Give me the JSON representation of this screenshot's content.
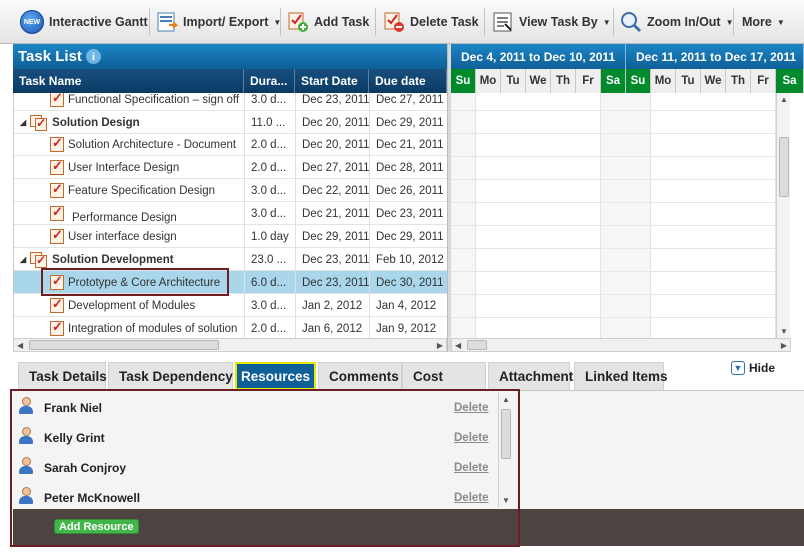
{
  "toolbar": {
    "items": [
      {
        "label": "Interactive Gantt",
        "icon": "new-badge-icon"
      },
      {
        "label": "Import/ Export",
        "icon": "import-export-icon",
        "dropdown": true
      },
      {
        "label": "Add Task",
        "icon": "add-task-icon"
      },
      {
        "label": "Delete Task",
        "icon": "delete-task-icon"
      },
      {
        "label": "View Task By",
        "icon": "view-task-icon",
        "dropdown": true
      },
      {
        "label": "Zoom In/Out",
        "icon": "zoom-icon",
        "dropdown": true
      },
      {
        "label": "More",
        "dropdown": true
      }
    ],
    "new_badge": "NEW"
  },
  "task_list": {
    "title": "Task List",
    "info_glyph": "i",
    "columns": [
      "Task Name",
      "Dura...",
      "Start Date",
      "Due date"
    ],
    "rows": [
      {
        "name": "Functional Specification – sign off",
        "duration": "3.0 d...",
        "start": "Dec 23, 2011",
        "due": "Dec 27, 2011",
        "level": 2
      },
      {
        "name": "Solution Design",
        "duration": "11.0 ...",
        "start": "Dec 20, 2011",
        "due": "Dec 29, 2011",
        "level": 0
      },
      {
        "name": "Solution Architecture - Document",
        "duration": "2.0 d...",
        "start": "Dec 20, 2011",
        "due": "Dec 21, 2011",
        "level": 1
      },
      {
        "name": "User Interface Design",
        "duration": "2.0 d...",
        "start": "Dec 27, 2011",
        "due": "Dec 28, 2011",
        "level": 1
      },
      {
        "name": "Feature Specification Design",
        "duration": "3.0 d...",
        "start": "Dec 22, 2011",
        "due": "Dec 26, 2011",
        "level": 1
      },
      {
        "name": "Performance Design",
        "duration": "3.0 d...",
        "start": "Dec 21, 2011",
        "due": "Dec 23, 2011",
        "level": 2
      },
      {
        "name": "User interface design",
        "duration": "1.0 day",
        "start": "Dec 29, 2011",
        "due": "Dec 29, 2011",
        "level": 1
      },
      {
        "name": "Solution Development",
        "duration": "23.0 ...",
        "start": "Dec 23, 2011",
        "due": "Feb 10, 2012",
        "level": 0
      },
      {
        "name": "Prototype & Core Architecture",
        "duration": "6.0 d...",
        "start": "Dec 23, 2011",
        "due": "Dec 30, 2011",
        "level": 1,
        "selected": true
      },
      {
        "name": "Development of Modules",
        "duration": "3.0 d...",
        "start": "Jan 2, 2012",
        "due": "Jan 4, 2012",
        "level": 1
      },
      {
        "name": "Integration of modules of solution",
        "duration": "2.0 d...",
        "start": "Jan 6, 2012",
        "due": "Jan 9, 2012",
        "level": 1
      }
    ]
  },
  "gantt": {
    "weeks": [
      "Dec 4, 2011 to Dec 10, 2011",
      "Dec 11, 2011 to Dec 17, 2011"
    ],
    "days": [
      "Su",
      "Mo",
      "Tu",
      "We",
      "Th",
      "Fr",
      "Sa",
      "Su",
      "Mo",
      "Tu",
      "We",
      "Th",
      "Fr",
      "Sa"
    ],
    "weekend_color": "#008a2b"
  },
  "tabs": {
    "items": [
      "Task Details",
      "Task Dependency",
      "Resources",
      "Comments",
      "Cost",
      "Attachment",
      "Linked Items"
    ],
    "active": "Resources",
    "hide_label": "Hide"
  },
  "resources": {
    "people": [
      {
        "name": "Frank Niel",
        "action": "Delete"
      },
      {
        "name": "Kelly Grint",
        "action": "Delete"
      },
      {
        "name": "Sarah Conjroy",
        "action": "Delete"
      },
      {
        "name": "Peter McKnowell",
        "action": "Delete"
      }
    ],
    "add_label": "Add Resource"
  },
  "colors": {
    "header_blue": "#0e5f96",
    "highlight_border": "#6d1d24",
    "selected_row": "#a9d6ea",
    "add_green": "#43b649"
  }
}
